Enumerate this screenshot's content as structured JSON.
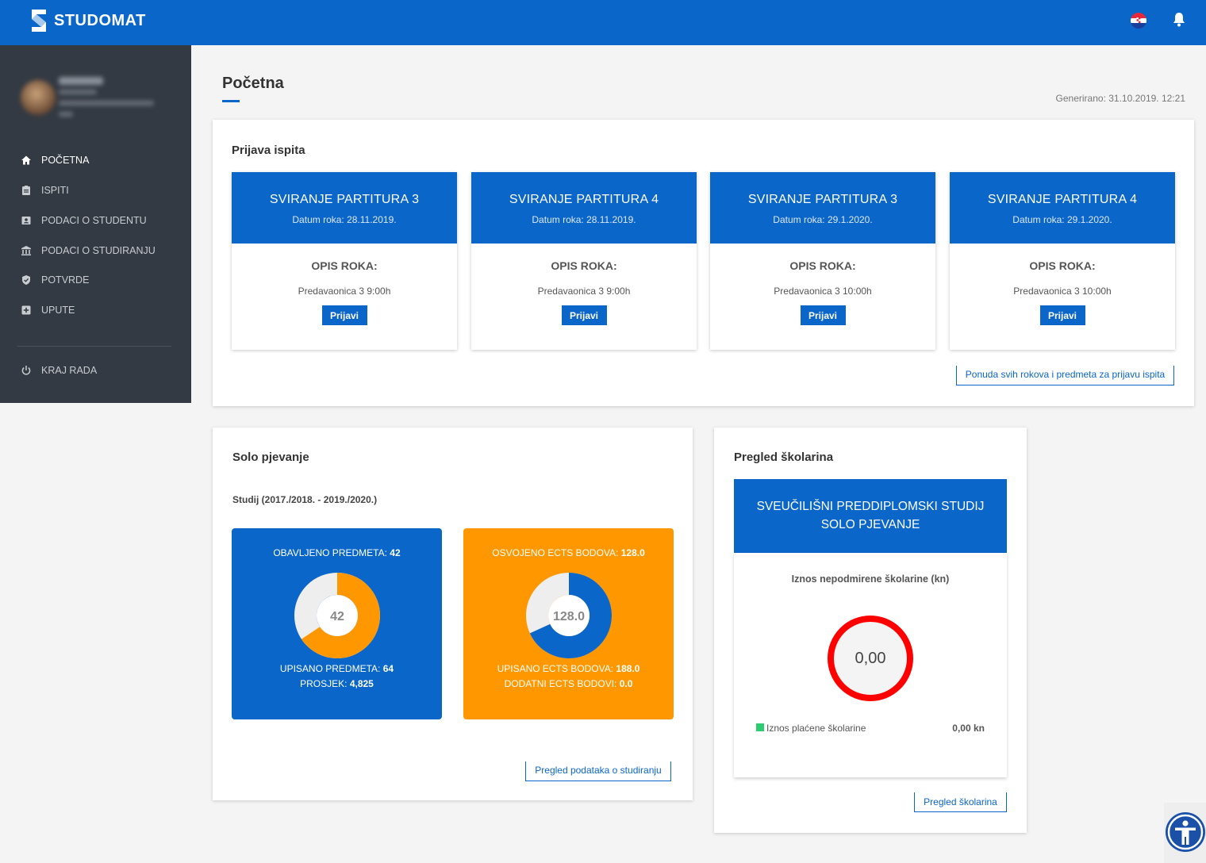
{
  "app": {
    "name": "STUDOMAT"
  },
  "header": {
    "language_icon": "croatian-flag-icon",
    "notification_icon": "bell-icon"
  },
  "sidebar": {
    "items": [
      {
        "label": "POČETNA",
        "icon": "home-icon",
        "active": true
      },
      {
        "label": "ISPITI",
        "icon": "clipboard-icon",
        "active": false
      },
      {
        "label": "PODACI O STUDENTU",
        "icon": "id-card-icon",
        "active": false
      },
      {
        "label": "PODACI O STUDIRANJU",
        "icon": "institution-icon",
        "active": false
      },
      {
        "label": "POTVRDE",
        "icon": "shield-check-icon",
        "active": false
      },
      {
        "label": "UPUTE",
        "icon": "plus-box-icon",
        "active": false
      }
    ],
    "logout": {
      "label": "KRAJ RADA",
      "icon": "power-icon"
    }
  },
  "page": {
    "title": "Početna",
    "generated": "Generirano: 31.10.2019. 12:21"
  },
  "exams": {
    "title": "Prijava ispita",
    "opis_label": "OPIS ROKA:",
    "button_label": "Prijavi",
    "cards": [
      {
        "name": "SVIRANJE PARTITURA 3",
        "date": "Datum roka: 28.11.2019.",
        "room": "Predavaonica 3 9:00h"
      },
      {
        "name": "SVIRANJE PARTITURA 4",
        "date": "Datum roka: 28.11.2019.",
        "room": "Predavaonica 3 9:00h"
      },
      {
        "name": "SVIRANJE PARTITURA 3",
        "date": "Datum roka: 29.1.2020.",
        "room": "Predavaonica 3 10:00h"
      },
      {
        "name": "SVIRANJE PARTITURA 4",
        "date": "Datum roka: 29.1.2020.",
        "room": "Predavaonica 3 10:00h"
      }
    ],
    "all_link": "Ponuda svih rokova i predmeta za prijavu ispita"
  },
  "study": {
    "title": "Solo pjevanje",
    "subtitle": "Studij (2017./2018. - 2019./2020.)",
    "subjects": {
      "done_label": "OBAVLJENO PREDMETA:",
      "done_value": "42",
      "center": "42",
      "enrolled_label": "UPISANO PREDMETA:",
      "enrolled_value": "64",
      "avg_label": "PROSJEK:",
      "avg_value": "4,825",
      "fraction": 0.65625,
      "color_bg": "#0a66c8",
      "color_fill": "#ff9800",
      "color_rest": "#eeeeee"
    },
    "ects": {
      "earned_label": "OSVOJENO ECTS BODOVA:",
      "earned_value": "128.0",
      "center": "128.0",
      "enrolled_label": "UPISANO ECTS BODOVA:",
      "enrolled_value": "188.0",
      "extra_label": "DODATNI ECTS BODOVI:",
      "extra_value": "0.0",
      "fraction": 0.6809,
      "color_bg": "#ff9800",
      "color_fill": "#0a66c8",
      "color_rest": "#eeeeee"
    },
    "link": "Pregled podataka o studiranju"
  },
  "fees": {
    "title": "Pregled školarina",
    "program_line1": "SVEUČILIŠNI PREDDIPLOMSKI STUDIJ",
    "program_line2": "SOLO PJEVANJE",
    "unpaid_label": "Iznos nepodmirene školarine (kn)",
    "unpaid_value": "0,00",
    "paid_label": "Iznos plaćene školarine",
    "paid_value": "0,00 kn",
    "link": "Pregled školarina"
  },
  "accessibility": {
    "icon": "accessibility-icon"
  }
}
